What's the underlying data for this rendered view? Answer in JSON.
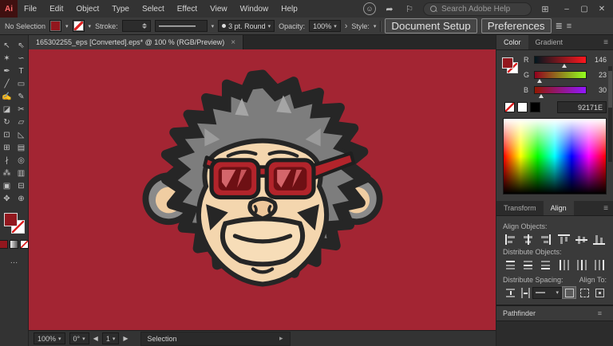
{
  "menubar": {
    "app_label": "Ai",
    "menus": [
      "File",
      "Edit",
      "Object",
      "Type",
      "Select",
      "Effect",
      "View",
      "Window",
      "Help"
    ],
    "search_placeholder": "Search Adobe Help"
  },
  "icons": {
    "caret": "▾",
    "burger": "≡",
    "user": "☺",
    "share": "➦",
    "location": "⚐",
    "workspace": "⊞",
    "minimize": "–",
    "maximize": "▢",
    "close": "✕",
    "chevron_right": "›",
    "prev": "◀",
    "next": "▶",
    "status_expand": "▸",
    "dots": "…",
    "brush_dot": "●",
    "rows": "≣"
  },
  "controlbar": {
    "no_selection": "No Selection",
    "stroke_label": "Stroke:",
    "brush_label": "3 pt. Round",
    "opacity_label": "Opacity:",
    "opacity_value": "100%",
    "style_label": "Style:",
    "document_setup_label": "Document Setup",
    "preferences_label": "Preferences"
  },
  "tab": {
    "title": "165302255_eps [Converted].eps* @ 100 % (RGB/Preview)",
    "close_label": "×"
  },
  "tools": [
    {
      "name": "selection-tool",
      "glyph": "↖"
    },
    {
      "name": "direct-selection-tool",
      "glyph": "⇖"
    },
    {
      "name": "magic-wand-tool",
      "glyph": "✶"
    },
    {
      "name": "lasso-tool",
      "glyph": "∽"
    },
    {
      "name": "pen-tool",
      "glyph": "✒"
    },
    {
      "name": "type-tool",
      "glyph": "T"
    },
    {
      "name": "line-segment-tool",
      "glyph": "╱"
    },
    {
      "name": "rectangle-tool",
      "glyph": "▭"
    },
    {
      "name": "paintbrush-tool",
      "glyph": "✍"
    },
    {
      "name": "pencil-tool",
      "glyph": "✎"
    },
    {
      "name": "eraser-tool",
      "glyph": "◪"
    },
    {
      "name": "scissors-tool",
      "glyph": "✂"
    },
    {
      "name": "rotate-tool",
      "glyph": "↻"
    },
    {
      "name": "scale-tool",
      "glyph": "▱"
    },
    {
      "name": "free-transform-tool",
      "glyph": "⊡"
    },
    {
      "name": "perspective-grid-tool",
      "glyph": "◺"
    },
    {
      "name": "mesh-tool",
      "glyph": "⊞"
    },
    {
      "name": "gradient-tool",
      "glyph": "▤"
    },
    {
      "name": "eyedropper-tool",
      "glyph": "∤"
    },
    {
      "name": "blend-tool",
      "glyph": "◎"
    },
    {
      "name": "symbol-sprayer-tool",
      "glyph": "⁂"
    },
    {
      "name": "column-graph-tool",
      "glyph": "▥"
    },
    {
      "name": "artboard-tool",
      "glyph": "▣"
    },
    {
      "name": "slice-tool",
      "glyph": "⊟"
    },
    {
      "name": "hand-tool",
      "glyph": "✥"
    },
    {
      "name": "zoom-tool",
      "glyph": "⊕"
    }
  ],
  "color_panel": {
    "tabs": [
      "Color",
      "Gradient"
    ],
    "sliders": [
      {
        "channel": "R",
        "value": 146
      },
      {
        "channel": "G",
        "value": 23
      },
      {
        "channel": "B",
        "value": 30
      }
    ],
    "hex": "92171E"
  },
  "align_panel": {
    "tabs": [
      "Transform",
      "Align"
    ],
    "align_objects_label": "Align Objects:",
    "distribute_objects_label": "Distribute Objects:",
    "distribute_spacing_label": "Distribute Spacing:",
    "align_to_label": "Align To:",
    "align_objects": [
      {
        "name": "align-horizontal-left-button",
        "variant": "h-left"
      },
      {
        "name": "align-horizontal-center-button",
        "variant": "h-center"
      },
      {
        "name": "align-horizontal-right-button",
        "variant": "h-right"
      },
      {
        "name": "align-vertical-top-button",
        "variant": "v-top"
      },
      {
        "name": "align-vertical-center-button",
        "variant": "v-middle"
      },
      {
        "name": "align-vertical-bottom-button",
        "variant": "v-bottom"
      }
    ],
    "distribute_objects": [
      {
        "name": "distribute-vertical-top-button",
        "variant": "dv-top"
      },
      {
        "name": "distribute-vertical-center-button",
        "variant": "dv-center"
      },
      {
        "name": "distribute-vertical-bottom-button",
        "variant": "dv-bottom"
      },
      {
        "name": "distribute-horizontal-left-button",
        "variant": "dh-left"
      },
      {
        "name": "distribute-horizontal-center-button",
        "variant": "dh-center"
      },
      {
        "name": "distribute-horizontal-right-button",
        "variant": "dh-right"
      }
    ],
    "distribute_spacing": [
      {
        "name": "distribute-vertical-space-button",
        "variant": "ds-v"
      },
      {
        "name": "distribute-horizontal-space-button",
        "variant": "ds-h"
      }
    ],
    "align_to": [
      {
        "name": "align-to-artboard-button",
        "variant": "at-art",
        "active": "true"
      },
      {
        "name": "align-to-selection-button",
        "variant": "at-sel"
      },
      {
        "name": "align-to-key-object-button",
        "variant": "at-key"
      }
    ]
  },
  "pathfinder": {
    "label": "Pathfinder"
  },
  "statusbar": {
    "zoom": "100%",
    "rotation": "0°",
    "artboard_number": "1",
    "status_label": "Selection"
  },
  "canvas": {
    "colors": {
      "artboard_background": "#a32533",
      "outline": "#262626",
      "fur_dark": "#262626",
      "fur_mid": "#7d7d7d",
      "face": "#f4d6ae",
      "muzzle": "#f7ddb8",
      "glasses_frame": "#b2242b",
      "lens": "#6e1014",
      "lens_highlight": "#d4666b"
    }
  }
}
